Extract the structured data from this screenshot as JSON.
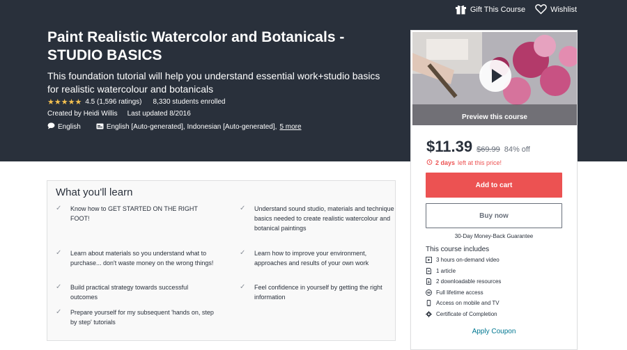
{
  "header": {
    "gift_label": "Gift This Course",
    "wishlist_label": "Wishlist"
  },
  "course": {
    "title": "Paint Realistic Watercolor and Botanicals - STUDIO BASICS",
    "subtitle": "This foundation tutorial will help you understand essential work+studio basics for realistic watercolour and botanicals",
    "stars": "★★★★★",
    "rating": "4.5 (1,596 ratings)",
    "enrolled": "8,330 students enrolled",
    "created_by": "Created by Heidi Willis",
    "last_updated": "Last updated 8/2016",
    "language": "English",
    "captions": "English [Auto-generated], Indonesian [Auto-generated],",
    "more_link": "5 more"
  },
  "sidebar": {
    "preview_label": "Preview this course",
    "price": "$11.39",
    "old_price": "$69.99",
    "discount": "84% off",
    "timer_bold": "2 days",
    "timer_rest": "left at this price!",
    "add_to_cart": "Add to cart",
    "buy_now": "Buy now",
    "guarantee": "30-Day Money-Back Guarantee",
    "includes_title": "This course includes",
    "includes": [
      {
        "icon": "video-icon",
        "label": "3 hours on-demand video"
      },
      {
        "icon": "article-icon",
        "label": "1 article"
      },
      {
        "icon": "resource-icon",
        "label": "2 downloadable resources"
      },
      {
        "icon": "infinity-icon",
        "label": "Full lifetime access"
      },
      {
        "icon": "mobile-icon",
        "label": "Access on mobile and TV"
      },
      {
        "icon": "certificate-icon",
        "label": "Certificate of Completion"
      }
    ],
    "coupon": "Apply Coupon"
  },
  "learn": {
    "title": "What you'll learn",
    "items": [
      "Know how to GET STARTED ON THE RIGHT FOOT!",
      "Understand sound studio, materials and technique basics needed to create realistic watercolour and botanical paintings",
      "Learn about materials so you understand what to purchase... don't waste money on the wrong things!",
      "Learn how to improve your environment, approaches and results of your own work",
      "Build practical strategy towards successful outcomes",
      "Feel confidence in yourself by getting the right information",
      "Prepare yourself for my subsequent 'hands on, step by step' tutorials"
    ]
  },
  "colors": {
    "hero_bg": "#29303b",
    "accent_red": "#ec5252",
    "star_gold": "#f4c150",
    "link": "#007791"
  }
}
